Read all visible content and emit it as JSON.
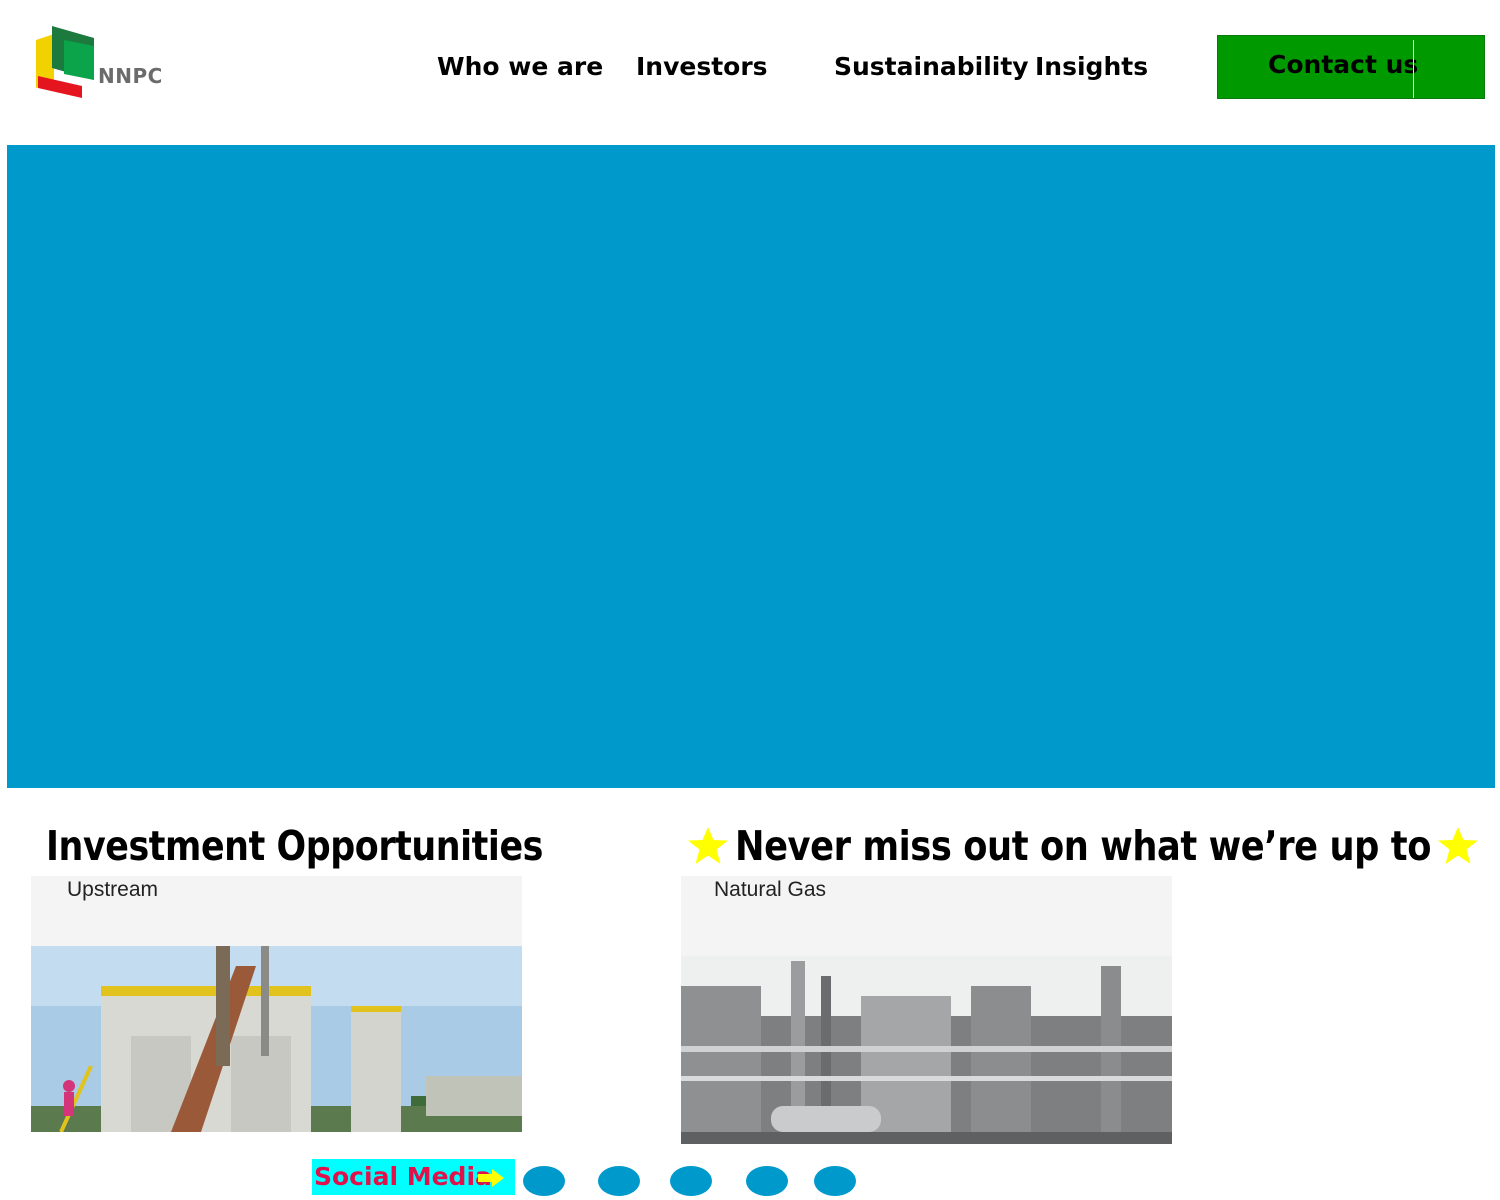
{
  "header": {
    "logo": {
      "text": "NNPC",
      "icon": "nnpc-logo-icon"
    },
    "nav": [
      {
        "label": "Who we are"
      },
      {
        "label": "Investors"
      },
      {
        "label": "Sustainability"
      },
      {
        "label": "Insights"
      }
    ],
    "contact_button": {
      "label": "Contact us",
      "color": "#009900"
    }
  },
  "hero": {
    "color": "#0099cc"
  },
  "sections": {
    "investment": {
      "title": "Investment Opportunities"
    },
    "news": {
      "title": "Never miss out on what we’re up to",
      "icon": "star-icon",
      "star_color": "#ffff00"
    }
  },
  "cards": [
    {
      "label": "Upstream",
      "image": "drilling-rig-photo"
    },
    {
      "label": "Natural Gas",
      "image": "gas-plant-photo"
    }
  ],
  "social": {
    "label": "Social Media",
    "arrow_icon": "arrow-right-icon",
    "badge_color": "#00ffff",
    "label_color": "#e0124c",
    "links": [
      {
        "icon": "social-icon-1"
      },
      {
        "icon": "social-icon-2"
      },
      {
        "icon": "social-icon-3"
      },
      {
        "icon": "social-icon-4"
      },
      {
        "icon": "social-icon-5"
      }
    ]
  }
}
